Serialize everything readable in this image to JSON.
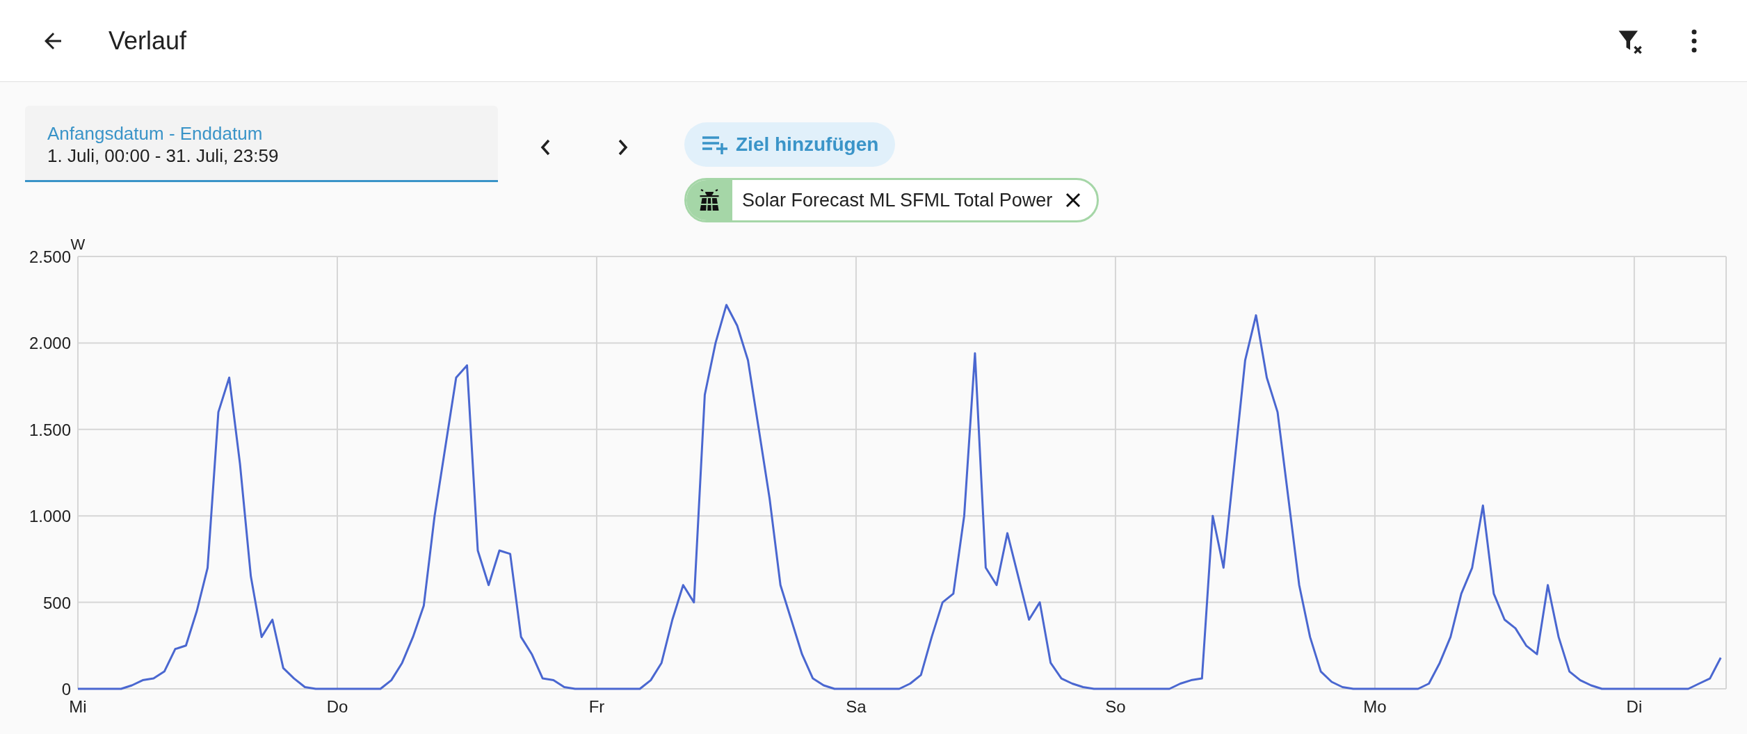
{
  "header": {
    "title": "Verlauf"
  },
  "date_range": {
    "label": "Anfangsdatum - Enddatum",
    "value": "1. Juli, 00:00 - 31. Juli, 23:59"
  },
  "add_target_button": {
    "label": "Ziel hinzufügen"
  },
  "targets": [
    {
      "label": "Solar Forecast ML SFML Total Power"
    }
  ],
  "chart": {
    "chart_data": {
      "type": "line",
      "ylabel": "W",
      "categories": [
        "Mi",
        null,
        null,
        null,
        null,
        null,
        null,
        null,
        null,
        null,
        null,
        null,
        null,
        null,
        null,
        null,
        null,
        null,
        null,
        null,
        null,
        null,
        null,
        null,
        "Do",
        null,
        null,
        null,
        null,
        null,
        null,
        null,
        null,
        null,
        null,
        null,
        null,
        null,
        null,
        null,
        null,
        null,
        null,
        null,
        null,
        null,
        null,
        null,
        "Fr",
        null,
        null,
        null,
        null,
        null,
        null,
        null,
        null,
        null,
        null,
        null,
        null,
        null,
        null,
        null,
        null,
        null,
        null,
        null,
        null,
        null,
        null,
        null,
        "Sa",
        null,
        null,
        null,
        null,
        null,
        null,
        null,
        null,
        null,
        null,
        null,
        null,
        null,
        null,
        null,
        null,
        null,
        null,
        null,
        null,
        null,
        null,
        null,
        "So",
        null,
        null,
        null,
        null,
        null,
        null,
        null,
        null,
        null,
        null,
        null,
        null,
        null,
        null,
        null,
        null,
        null,
        null,
        null,
        null,
        null,
        null,
        null,
        "Mo",
        null,
        null,
        null,
        null,
        null,
        null,
        null,
        null,
        null,
        null,
        null,
        null,
        null,
        null,
        null,
        null,
        null,
        null,
        null,
        null,
        null,
        null,
        null,
        "Di",
        null,
        null,
        null,
        null,
        null,
        null,
        null,
        null
      ],
      "series": [
        {
          "color": "#4a67d0",
          "values": [
            0,
            0,
            0,
            0,
            0,
            20,
            50,
            60,
            100,
            230,
            250,
            450,
            700,
            1600,
            1800,
            1300,
            650,
            300,
            400,
            120,
            60,
            10,
            0,
            0,
            0,
            0,
            0,
            0,
            0,
            50,
            150,
            300,
            480,
            1000,
            1400,
            1800,
            1870,
            800,
            600,
            800,
            780,
            300,
            200,
            60,
            50,
            10,
            0,
            0,
            0,
            0,
            0,
            0,
            0,
            50,
            150,
            400,
            600,
            500,
            1700,
            2000,
            2220,
            2100,
            1900,
            1500,
            1100,
            600,
            400,
            200,
            60,
            20,
            0,
            0,
            0,
            0,
            0,
            0,
            0,
            30,
            80,
            300,
            500,
            550,
            1000,
            1940,
            700,
            600,
            900,
            650,
            400,
            500,
            150,
            60,
            30,
            10,
            0,
            0,
            0,
            0,
            0,
            0,
            0,
            0,
            30,
            50,
            60,
            1000,
            700,
            1300,
            1900,
            2160,
            1800,
            1600,
            1100,
            600,
            300,
            100,
            40,
            10,
            0,
            0,
            0,
            0,
            0,
            0,
            0,
            30,
            150,
            300,
            550,
            700,
            1060,
            550,
            400,
            350,
            250,
            200,
            600,
            300,
            100,
            50,
            20,
            0,
            0,
            0,
            0,
            0,
            0,
            0,
            0,
            0,
            30,
            60,
            180
          ]
        }
      ],
      "ylim": [
        0,
        2500
      ],
      "grid": true,
      "yticks": [
        {
          "value": 0,
          "label": "0"
        },
        {
          "value": 500,
          "label": "500"
        },
        {
          "value": 1000,
          "label": "1.000"
        },
        {
          "value": 1500,
          "label": "1.500"
        },
        {
          "value": 2000,
          "label": "2.000"
        },
        {
          "value": 2500,
          "label": "2.500"
        }
      ]
    }
  }
}
